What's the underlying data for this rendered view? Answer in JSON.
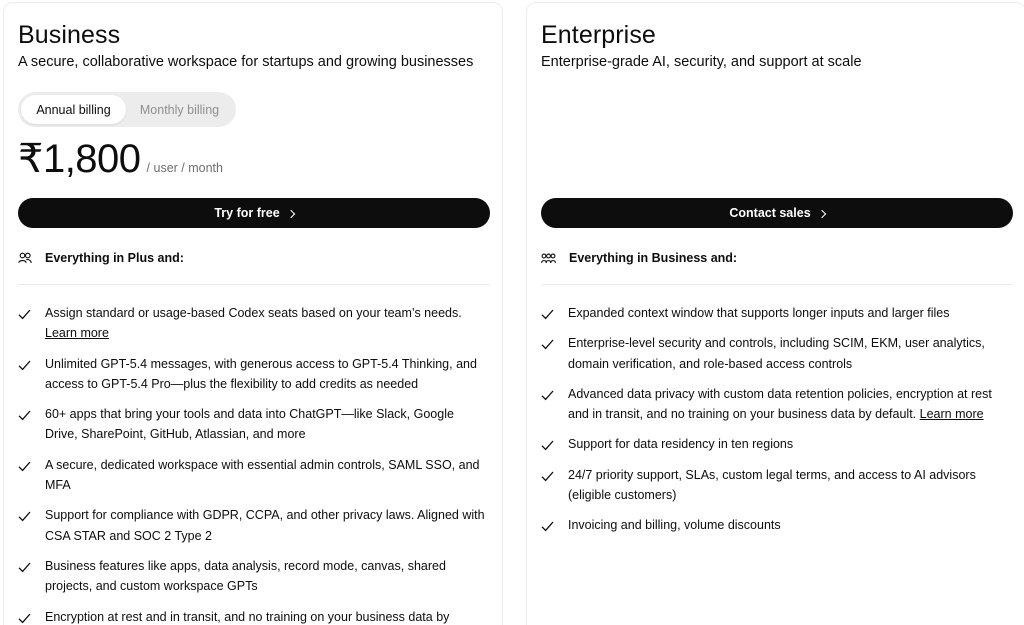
{
  "business": {
    "title": "Business",
    "subtitle": "A secure, collaborative workspace for startups and growing businesses",
    "billing": {
      "annual": "Annual billing",
      "monthly": "Monthly billing",
      "selected": "Annual billing"
    },
    "price": "₹1,800",
    "price_unit": "/ user / month",
    "cta": "Try for free",
    "includes": "Everything in Plus and:",
    "features": [
      {
        "text": "Assign standard or usage-based Codex seats based on your team’s needs.",
        "link": "Learn more"
      },
      {
        "text": "Unlimited GPT-5.4 messages, with generous access to GPT-5.4 Thinking, and access to GPT-5.4 Pro—plus the flexibility to add credits as needed"
      },
      {
        "text": "60+ apps that bring your tools and data into ChatGPT—like Slack, Google Drive, SharePoint, GitHub, Atlassian, and more"
      },
      {
        "text": "A secure, dedicated workspace with essential admin controls, SAML SSO, and MFA"
      },
      {
        "text": "Support for compliance with GDPR, CCPA, and other privacy laws. Aligned with CSA STAR and SOC 2 Type 2"
      },
      {
        "text": "Business features like apps, data analysis, record mode, canvas, shared projects, and custom workspace GPTs"
      },
      {
        "text": "Encryption at rest and in transit, and no training on your business data by"
      }
    ]
  },
  "enterprise": {
    "title": "Enterprise",
    "subtitle": "Enterprise-grade AI, security, and support at scale",
    "cta": "Contact sales",
    "includes": "Everything in Business and:",
    "features": [
      {
        "text": "Expanded context window that supports longer inputs and larger files"
      },
      {
        "text": "Enterprise-level security and controls, including SCIM, EKM, user analytics, domain verification, and role-based access controls"
      },
      {
        "text": "Advanced data privacy with custom data retention policies, encryption at rest and in transit, and no training on your business data by default.",
        "link": "Learn more"
      },
      {
        "text": "Support for data residency in ten regions"
      },
      {
        "text": "24/7 priority support, SLAs, custom legal terms, and access to AI advisors (eligible customers)"
      },
      {
        "text": "Invoicing and billing, volume discounts"
      }
    ]
  },
  "icons": {
    "check": "check-icon",
    "people": "people-icon",
    "chevron": "chevron-right-icon"
  }
}
